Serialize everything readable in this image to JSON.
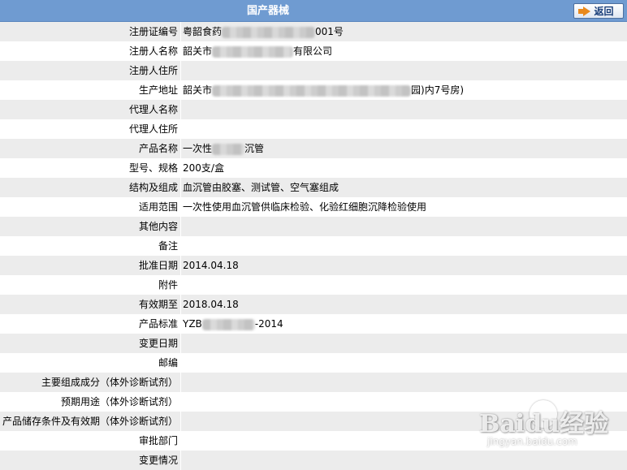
{
  "header": {
    "title": "国产器械",
    "back_label": "返回"
  },
  "rows": [
    {
      "label": "注册证编号",
      "value_parts": [
        "粤韶食药",
        "###",
        "001号"
      ]
    },
    {
      "label": "注册人名称",
      "value_parts": [
        "韶关市",
        "###",
        "有限公司"
      ]
    },
    {
      "label": "注册人住所",
      "value_parts": [
        ""
      ]
    },
    {
      "label": "生产地址",
      "value_parts": [
        "韶关市",
        "###",
        "园)内7号房)"
      ]
    },
    {
      "label": "代理人名称",
      "value_parts": [
        ""
      ]
    },
    {
      "label": "代理人住所",
      "value_parts": [
        ""
      ]
    },
    {
      "label": "产品名称",
      "value_parts": [
        "一次性",
        "###",
        "沉管"
      ]
    },
    {
      "label": "型号、规格",
      "value_parts": [
        "200支/盒"
      ]
    },
    {
      "label": "结构及组成",
      "value_parts": [
        "血沉管由胶塞、测试管、空气塞组成"
      ]
    },
    {
      "label": "适用范围",
      "value_parts": [
        "一次性使用血沉管供临床检验、化验红细胞沉降检验使用"
      ]
    },
    {
      "label": "其他内容",
      "value_parts": [
        ""
      ]
    },
    {
      "label": "备注",
      "value_parts": [
        ""
      ]
    },
    {
      "label": "批准日期",
      "value_parts": [
        "2014.04.18"
      ]
    },
    {
      "label": "附件",
      "value_parts": [
        ""
      ]
    },
    {
      "label": "有效期至",
      "value_parts": [
        "2018.04.18"
      ]
    },
    {
      "label": "产品标准",
      "value_parts": [
        "YZB",
        "###",
        "-2014"
      ]
    },
    {
      "label": "变更日期",
      "value_parts": [
        ""
      ]
    },
    {
      "label": "邮编",
      "value_parts": [
        ""
      ]
    },
    {
      "label": "主要组成成分（体外诊断试剂）",
      "value_parts": [
        ""
      ]
    },
    {
      "label": "预期用途（体外诊断试剂）",
      "value_parts": [
        ""
      ]
    },
    {
      "label": "产品储存条件及有效期（体外诊断试剂）",
      "value_parts": [
        ""
      ]
    },
    {
      "label": "审批部门",
      "value_parts": [
        ""
      ]
    },
    {
      "label": "变更情况",
      "value_parts": [
        ""
      ]
    }
  ],
  "watermark": {
    "brand": "Baidu经验",
    "url": "jingyan.baidu.com"
  },
  "colors": {
    "header": "#6f9bd1",
    "row_alt": "#ececec",
    "accent": "#e8891d"
  }
}
